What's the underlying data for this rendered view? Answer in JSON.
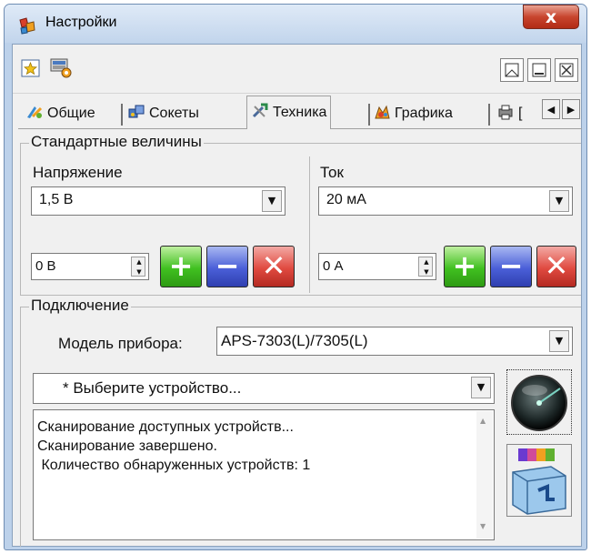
{
  "window": {
    "title": "Настройки",
    "close_label": "x"
  },
  "tabs": [
    {
      "label": "Общие",
      "icon": "settings-icon"
    },
    {
      "label": "Сокеты",
      "icon": "sockets-icon"
    },
    {
      "label": "Техника",
      "icon": "tools-icon"
    },
    {
      "label": "Графика",
      "icon": "graphics-icon"
    },
    {
      "label": "[",
      "icon": "printer-icon"
    }
  ],
  "standard": {
    "title": "Стандартные величины",
    "voltage": {
      "label": "Напряжение",
      "selected": "1,5 В",
      "spin_value": "0 В"
    },
    "current": {
      "label": "Ток",
      "selected": "20 мА",
      "spin_value": "0 А"
    },
    "add_glyph": "+",
    "remove_glyph": "−",
    "delete_glyph": "✕"
  },
  "connection": {
    "title": "Подключение",
    "model_label": "Модель прибора:",
    "model_value": "APS-7303(L)/7305(L)",
    "device_value": "* Выберите устройство...",
    "log": [
      "Сканирование доступных устройств...",
      "Сканирование завершено.",
      " Количество обнаруженных устройств: 1"
    ]
  },
  "colors": {
    "title_bar": "#c7d8ee",
    "close_red": "#c8452e",
    "panel": "#f0f0f0"
  }
}
